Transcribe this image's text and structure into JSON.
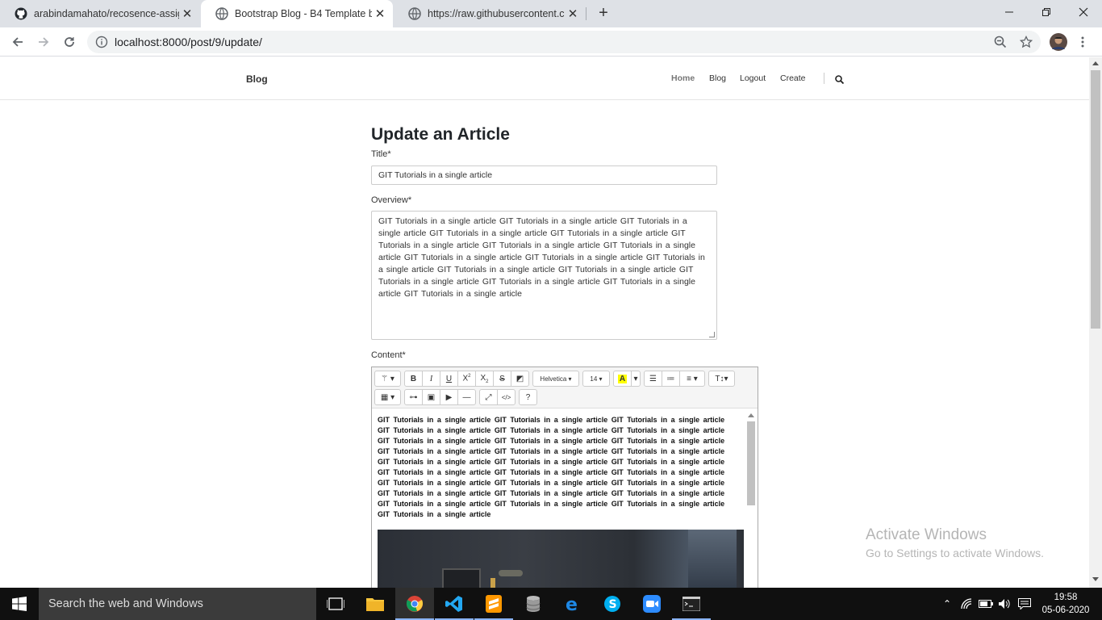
{
  "browser": {
    "tabs": [
      {
        "title": "arabindamahato/recosence-assig",
        "icon": "github-icon",
        "active": false
      },
      {
        "title": "Bootstrap Blog - B4 Template by",
        "icon": "globe-icon",
        "active": true
      },
      {
        "title": "https://raw.githubusercontent.co",
        "icon": "globe-icon",
        "active": false
      }
    ],
    "url": "localhost:8000/post/9/update/"
  },
  "site": {
    "brand": "Blog",
    "nav": [
      "Home",
      "Blog",
      "Logout",
      "Create"
    ]
  },
  "form": {
    "heading": "Update an Article",
    "title_label": "Title*",
    "title_value": "GIT Tutorials in a single article",
    "overview_label": "Overview*",
    "overview_value": "GIT Tutorials in a single article    GIT Tutorials in a single article    GIT Tutorials in a single article    GIT Tutorials in a single article    GIT Tutorials in a single article    GIT Tutorials in a single article    GIT Tutorials in a single article    GIT Tutorials in a single article    GIT Tutorials in a single article    GIT Tutorials in a single article    GIT Tutorials in a single article    GIT Tutorials in a single article    GIT Tutorials in a single article    GIT Tutorials in a single article    GIT Tutorials in a single article    GIT Tutorials in a single article    GIT Tutorials in a single article",
    "content_label": "Content*",
    "content_value": "GIT Tutorials in a single article    GIT Tutorials in a single article    GIT Tutorials in a single article    GIT Tutorials in a single article    GIT Tutorials in a single article    GIT Tutorials in a single article    GIT Tutorials in a single article    GIT Tutorials in a single article    GIT Tutorials in a single article    GIT Tutorials in a single article    GIT Tutorials in a single article    GIT Tutorials in a single article    GIT Tutorials in a single article    GIT Tutorials in a single article    GIT Tutorials in a single article    GIT Tutorials in a single article    GIT Tutorials in a single article    GIT Tutorials in a single article    GIT Tutorials in a single article    GIT Tutorials in a single article    GIT Tutorials in a single article    GIT Tutorials in a single article    GIT Tutorials in a single article    GIT Tutorials in a single article    GIT Tutorials in a single article    GIT Tutorials in a single article    GIT Tutorials in a single article    GIT Tutorials in a single article"
  },
  "editor_toolbar": {
    "font_name": "Helvetica",
    "font_size": "14"
  },
  "watermark": {
    "line1": "Activate Windows",
    "line2": "Go to Settings to activate Windows."
  },
  "taskbar": {
    "search_placeholder": "Search the web and Windows",
    "time": "19:58",
    "date": "05-06-2020"
  }
}
